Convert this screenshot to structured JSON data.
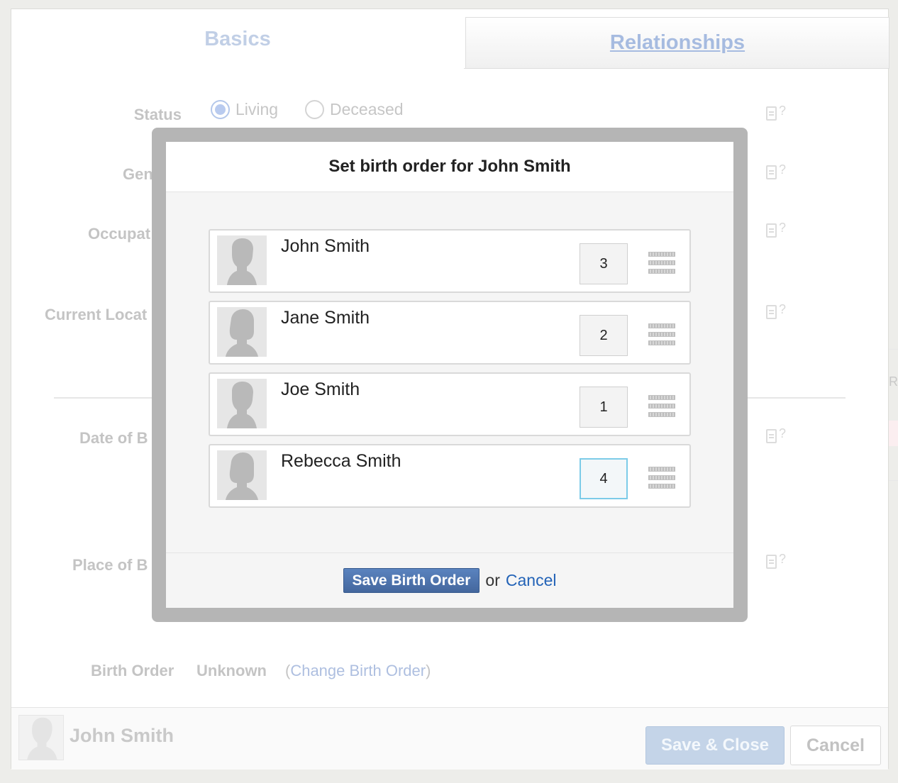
{
  "tabs": {
    "basics": "Basics",
    "relationships": "Relationships"
  },
  "form": {
    "status_label": "Status",
    "status_options": [
      "Living",
      "Deceased"
    ],
    "status_selected": "Living",
    "gender_label": "Gen",
    "occupation_label": "Occupat",
    "current_location_label": "Current Locat",
    "date_of_birth_label": "Date of B",
    "place_of_birth_label": "Place of B",
    "birth_order_label": "Birth Order",
    "birth_order_value": "Unknown",
    "birth_order_paren_open": "(",
    "change_birth_order_link": "Change Birth Order",
    "birth_order_paren_close": ")",
    "help_glyph": "?",
    "edge_text": "R"
  },
  "footer": {
    "person_name": "John Smith",
    "save_close_label": "Save & Close",
    "cancel_label": "Cancel"
  },
  "modal": {
    "title": "Set birth order for John Smith",
    "siblings": [
      {
        "name": "John Smith",
        "order": "3",
        "gender": "male",
        "active": false
      },
      {
        "name": "Jane Smith",
        "order": "2",
        "gender": "female",
        "active": false
      },
      {
        "name": "Joe Smith",
        "order": "1",
        "gender": "male",
        "active": false
      },
      {
        "name": "Rebecca Smith",
        "order": "4",
        "gender": "female",
        "active": true
      }
    ],
    "save_label": "Save Birth Order",
    "or_text": "or",
    "cancel_label": "Cancel"
  },
  "colors": {
    "primary_button": "#4d72ab",
    "link": "#2363b7",
    "active_input_border": "#7ccbe8"
  },
  "icons": {
    "avatar": "person-silhouette-icon",
    "drag": "drag-handle-icon",
    "help": "help-page-icon"
  }
}
